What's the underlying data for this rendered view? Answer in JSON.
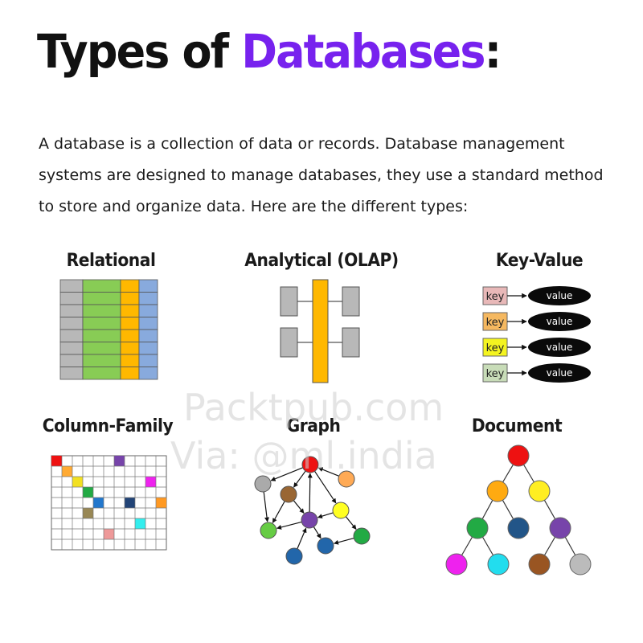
{
  "header": {
    "title_main": "Types of ",
    "title_accent": "Databases",
    "title_colon": ":"
  },
  "intro": "A database is a collection of data or records. Database management systems are designed to manage databases, they use a standard method to store and organize data. Here are the different types:",
  "types": {
    "relational": "Relational",
    "analytical": "Analytical (OLAP)",
    "key_value": "Key-Value",
    "column_family": "Column-Family",
    "graph": "Graph",
    "document": "Document"
  },
  "key_value": {
    "key_label": "key",
    "value_label": "value",
    "key_colors": [
      "#e8b8b8",
      "#f5b860",
      "#f4f420",
      "#c8dcb8"
    ]
  },
  "watermark": {
    "line1": "Packtpub.com",
    "line2": "Via: @ml.india"
  },
  "colors": {
    "accent": "#7722ee",
    "gray": "#b8b8b8",
    "green": "#88cc55",
    "orange": "#ffb800",
    "blue": "#88aadd"
  },
  "column_family": {
    "cells": [
      {
        "col": 0,
        "row": 0,
        "color": "#ee1111"
      },
      {
        "col": 6,
        "row": 0,
        "color": "#7744aa"
      },
      {
        "col": 1,
        "row": 1,
        "color": "#ffaa33"
      },
      {
        "col": 2,
        "row": 2,
        "color": "#f2e022"
      },
      {
        "col": 9,
        "row": 2,
        "color": "#ee22ee"
      },
      {
        "col": 3,
        "row": 3,
        "color": "#22aa44"
      },
      {
        "col": 4,
        "row": 4,
        "color": "#2277cc"
      },
      {
        "col": 7,
        "row": 4,
        "color": "#224477"
      },
      {
        "col": 10,
        "row": 4,
        "color": "#ff9922"
      },
      {
        "col": 3,
        "row": 5,
        "color": "#998855"
      },
      {
        "col": 8,
        "row": 6,
        "color": "#33eeee"
      },
      {
        "col": 5,
        "row": 7,
        "color": "#ee9999"
      }
    ]
  },
  "graph": {
    "nodes": [
      {
        "id": "a",
        "color": "#ee1111"
      },
      {
        "id": "b",
        "color": "#aaaaaa"
      },
      {
        "id": "c",
        "color": "#996633"
      },
      {
        "id": "d",
        "color": "#ffaa55"
      },
      {
        "id": "e",
        "color": "#ffff22"
      },
      {
        "id": "f",
        "color": "#7744aa"
      },
      {
        "id": "g",
        "color": "#66cc44"
      },
      {
        "id": "h",
        "color": "#22aa44"
      },
      {
        "id": "i",
        "color": "#2266aa"
      },
      {
        "id": "j",
        "color": "#2266aa"
      }
    ]
  },
  "document": {
    "nodes": [
      {
        "id": "root",
        "color": "#ee1111"
      },
      {
        "id": "l1a",
        "color": "#ffaa11"
      },
      {
        "id": "l1b",
        "color": "#ffee22"
      },
      {
        "id": "l2a",
        "color": "#22aa44"
      },
      {
        "id": "l2b",
        "color": "#225588"
      },
      {
        "id": "l2c",
        "color": "#7744aa"
      },
      {
        "id": "l3a",
        "color": "#ee22ee"
      },
      {
        "id": "l3b",
        "color": "#22ddee"
      },
      {
        "id": "l3c",
        "color": "#995522"
      },
      {
        "id": "l3d",
        "color": "#bbbbbb"
      }
    ]
  }
}
